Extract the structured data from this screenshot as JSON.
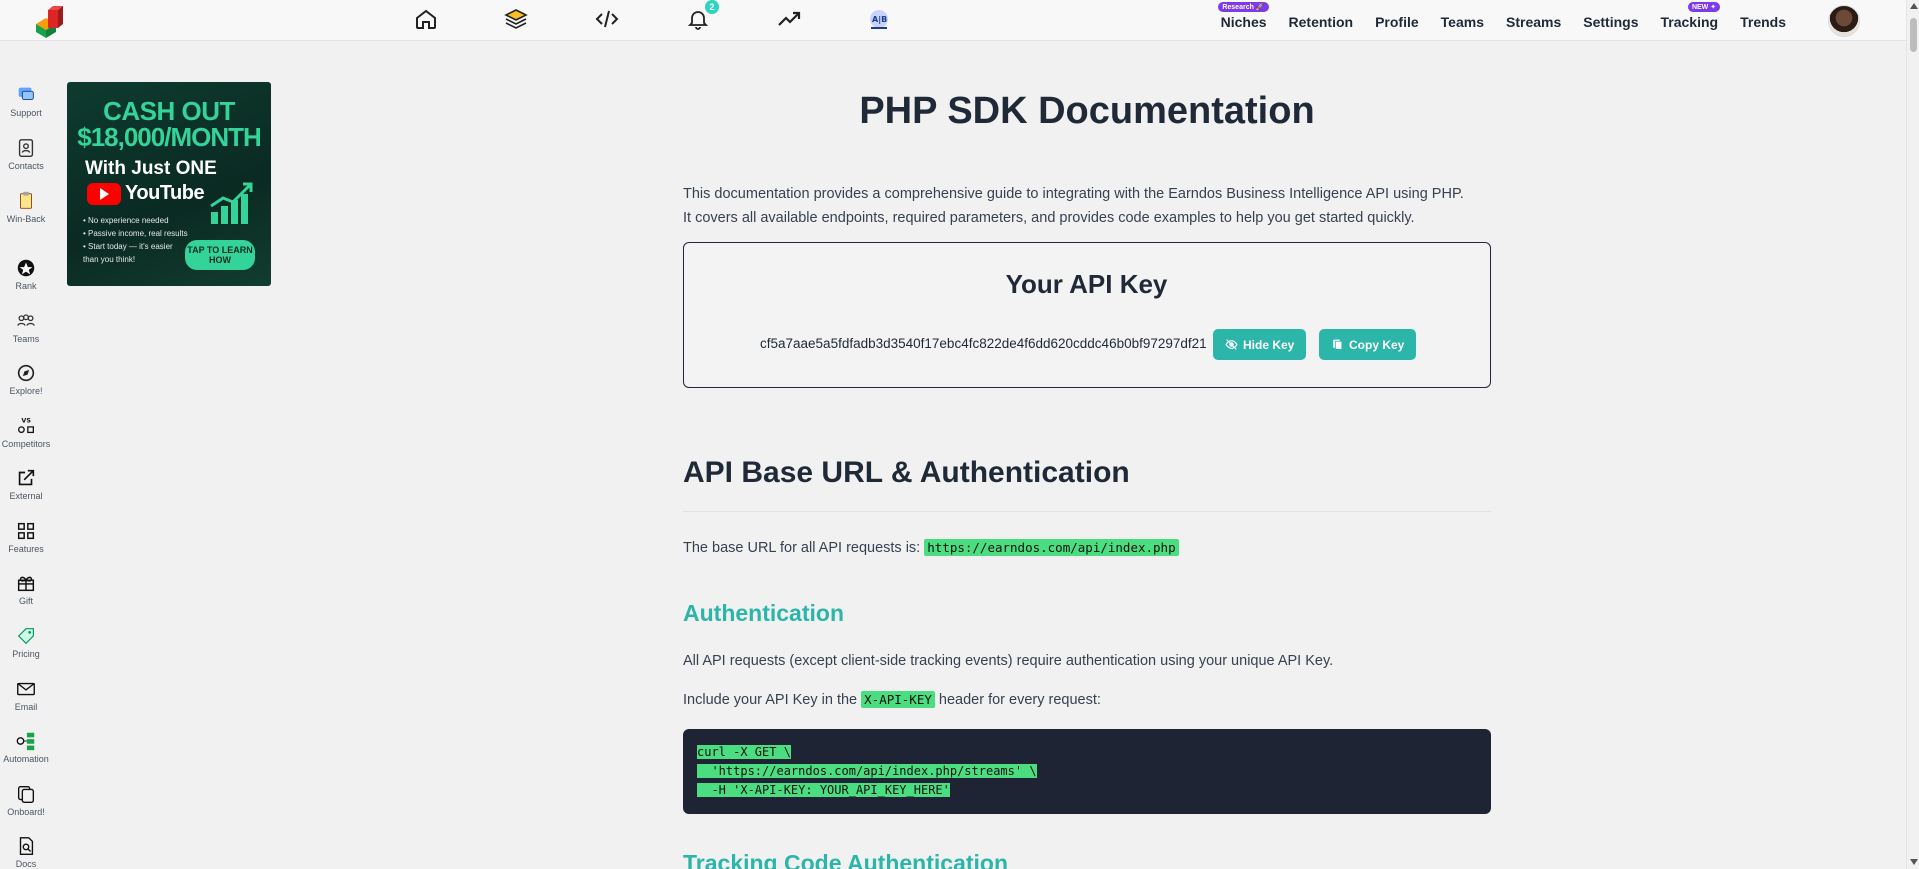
{
  "topbar": {
    "nav": [
      {
        "label": "Niches",
        "badge": "Research 🚀"
      },
      {
        "label": "Retention",
        "badge": ""
      },
      {
        "label": "Profile",
        "badge": ""
      },
      {
        "label": "Teams",
        "badge": ""
      },
      {
        "label": "Streams",
        "badge": ""
      },
      {
        "label": "Settings",
        "badge": ""
      },
      {
        "label": "Tracking",
        "badge": "NEW ✦"
      },
      {
        "label": "Trends",
        "badge": ""
      }
    ],
    "notification_count": "2",
    "icons": [
      "home-icon",
      "layers-icon",
      "code-icon",
      "bell-icon",
      "trending-icon",
      "ab-test-icon"
    ]
  },
  "sidebar": {
    "items": [
      {
        "label": "Support",
        "icon": "support-chat-icon"
      },
      {
        "label": "Contacts",
        "icon": "contacts-book-icon"
      },
      {
        "label": "Win-Back",
        "icon": "clipboard-icon"
      },
      {
        "label": "Rank",
        "icon": "rank-star-icon"
      },
      {
        "label": "Teams",
        "icon": "teams-icon"
      },
      {
        "label": "Explore!",
        "icon": "compass-icon"
      },
      {
        "label": "Competitors",
        "icon": "versus-icon"
      },
      {
        "label": "External",
        "icon": "external-link-icon"
      },
      {
        "label": "Features",
        "icon": "grid-icon"
      },
      {
        "label": "Gift",
        "icon": "gift-icon"
      },
      {
        "label": "Pricing",
        "icon": "price-tag-icon"
      },
      {
        "label": "Email",
        "icon": "mail-icon"
      },
      {
        "label": "Automation",
        "icon": "automation-icon"
      },
      {
        "label": "Onboard!",
        "icon": "copy-icon"
      },
      {
        "label": "Docs",
        "icon": "doc-search-icon"
      }
    ]
  },
  "ad": {
    "line1": "CASH OUT",
    "line2": "$18,000/MONTH",
    "line3": "With Just ONE",
    "brand": "YouTube",
    "bullets": [
      "• No experience needed",
      "• Passive income, real results",
      "• Start today — it's easier",
      "  than you think!"
    ],
    "cta": "TAP TO LEARN HOW"
  },
  "main": {
    "title": "PHP SDK Documentation",
    "intro_line1": "This documentation provides a comprehensive guide to integrating with the Earndos Business Intelligence API using PHP.",
    "intro_line2": "It covers all available endpoints, required parameters, and provides code examples to help you get started quickly.",
    "api_key": {
      "title": "Your API Key",
      "value": "cf5a7aae5a5fdfadb3d3540f17ebc4fc822de4f6dd620cddc46b0bf97297df21",
      "hide_label": "Hide Key",
      "copy_label": "Copy Key"
    },
    "base_url_section": {
      "heading": "API Base URL & Authentication",
      "text": "The base URL for all API requests is:",
      "url": "https://earndos.com/api/index.php"
    },
    "authentication": {
      "heading": "Authentication",
      "text1": "All API requests (except client-side tracking events) require authentication using your unique API Key.",
      "text2_before": "Include your API Key in the",
      "header_name": "X-API-KEY",
      "text2_after": "header for every request:",
      "code": [
        "curl -X GET \\",
        "  'https://earndos.com/api/index.php/streams' \\",
        "  -H 'X-API-KEY: YOUR_API_KEY_HERE'"
      ]
    },
    "tracking_heading": "Tracking Code Authentication"
  },
  "colors": {
    "accent": "#2cb5a9",
    "code_highlight": "#4ade80",
    "code_bg": "#1e2433",
    "badge_purple": "#7c3aed"
  }
}
